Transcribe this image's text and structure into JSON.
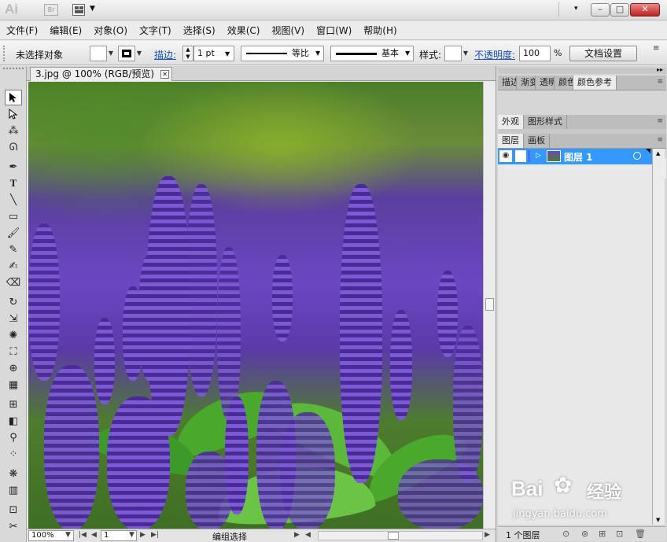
{
  "app": {
    "logo": "Ai",
    "bridge_label": "Br"
  },
  "window_controls": {
    "dropdown": "▾",
    "minimize": "–",
    "maximize": "□",
    "close": "✕"
  },
  "menu": [
    "文件(F)",
    "编辑(E)",
    "对象(O)",
    "文字(T)",
    "选择(S)",
    "效果(C)",
    "视图(V)",
    "窗口(W)",
    "帮助(H)"
  ],
  "control": {
    "selection": "未选择对象",
    "stroke_label": "描边:",
    "stroke_weight": "1 pt",
    "profile": "等比",
    "brush": "基本",
    "style_label": "样式:",
    "opacity_label": "不透明度:",
    "opacity_value": "100",
    "opacity_unit": "%",
    "doc_setup": "文档设置"
  },
  "document": {
    "tab_title": "3.jpg @ 100% (RGB/预览)",
    "close": "✕"
  },
  "status": {
    "zoom": "100%",
    "page": "1",
    "mode": "编组选择"
  },
  "panels": {
    "group1": [
      "描边",
      "渐变",
      "透明",
      "颜色",
      "颜色参考"
    ],
    "group2": [
      "外观",
      "图形样式"
    ],
    "group3": [
      "图层",
      "画板"
    ],
    "layer_name": "图层 1",
    "layer_count": "1 个图层"
  },
  "colors": {
    "accent": "#3399ff",
    "close": "#c0392b",
    "link": "#1a4fb8"
  },
  "guide_colors": [
    "#bfb4ae",
    "#c8bebc",
    "#c2f2dc",
    "#b2aee8"
  ],
  "watermark": {
    "brand": "Bai",
    "brand2": "经验",
    "url": "jingyan.baidu.com"
  },
  "icons": {
    "eye": "👁"
  }
}
